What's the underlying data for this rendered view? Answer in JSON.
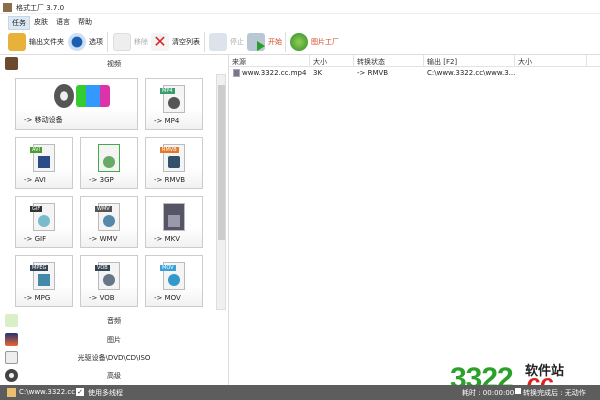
{
  "window": {
    "title": "格式工厂 3.7.0"
  },
  "menu": [
    "任务",
    "皮肤",
    "语言",
    "帮助"
  ],
  "toolbar": {
    "output_folder": "输出文件夹",
    "options": "选项",
    "remove": "移除",
    "clear_list": "清空列表",
    "stop": "停止",
    "start": "开始",
    "picture_factory": "图片工厂"
  },
  "left": {
    "video_label": "视频",
    "tiles": [
      "-> 移动设备",
      "-> MP4",
      "-> AVI",
      "-> 3GP",
      "-> RMVB",
      "-> GIF",
      "-> WMV",
      "-> MKV",
      "-> MPG",
      "-> VOB",
      "-> MOV"
    ],
    "tags": [
      "",
      "MP4",
      "AVI",
      "",
      "RMVB",
      "GIF",
      "WMV",
      "",
      "MPEG",
      "VOB",
      "MOV"
    ],
    "categories": [
      "音频",
      "图片",
      "光驱设备\\DVD\\CD\\ISO",
      "高级"
    ]
  },
  "list": {
    "columns": [
      "来源",
      "大小",
      "转换状态",
      "输出 [F2]",
      "大小"
    ],
    "rows": [
      {
        "source": "www.3322.cc.mp4",
        "size": "3K",
        "status": "-> RMVB",
        "output": "C:\\www.3322.cc\\www.3...",
        "out_size": ""
      }
    ]
  },
  "status": {
    "path": "C:\\www.3322.cc",
    "multithread": "使用多线程",
    "multithread_checked": true,
    "elapsed": "耗时 : 00:00:00",
    "after": "转换完成后 : 无动作"
  },
  "watermark": {
    "number": "3322",
    "suffix": ".cc",
    "site": "软件站"
  }
}
